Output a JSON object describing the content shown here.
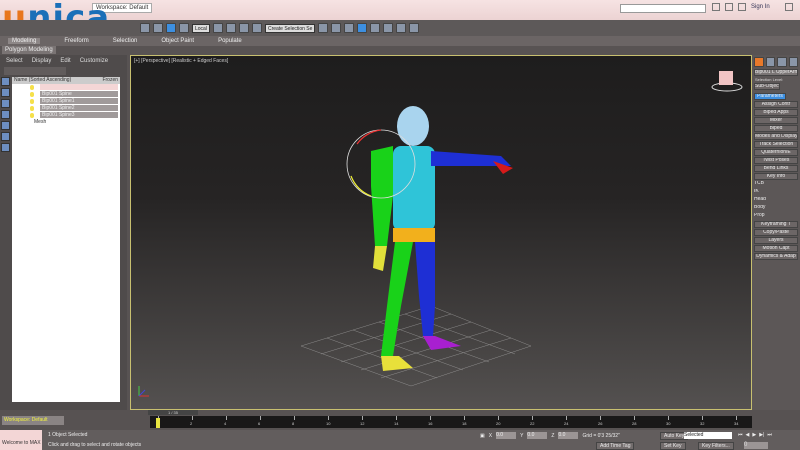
{
  "title": {
    "workspace": "Workspace: Default",
    "sign_in": "Sign In",
    "logo": "unica"
  },
  "toolbar": {
    "coord": "Local",
    "named_selection": "Create Selection Se"
  },
  "ribbon": {
    "tabs": [
      "Modeling",
      "Freeform",
      "Selection",
      "Object Paint",
      "Populate"
    ],
    "sub": "Polygon Modeling"
  },
  "explorer": {
    "menu": [
      "Select",
      "Display",
      "Edit",
      "Customize"
    ],
    "col_name": "Name (Sorted Ascending)",
    "col_frozen": "Frozen",
    "items": [
      "",
      "Bip001 Spine",
      "Bip001 Spine1",
      "Bip001 Spine2",
      "Bip001 Spine3",
      "Mesh"
    ]
  },
  "viewport": {
    "label": "[+] [Perspective] [Realistic + Edged Faces]"
  },
  "command_panel": {
    "object": "Bip001 L UpperArm",
    "selection_level": "Selection Level:",
    "sub_object": "Sub-Object",
    "parameters": "Parameters",
    "rollouts": [
      "Assign Contr",
      "Biped Apps",
      "Mixer",
      "Biped",
      "Modes and Display",
      "Track Selection",
      "Quaternion/E",
      "Twist Poses",
      "Bend Links",
      "Key Info",
      "TCB",
      "IK",
      "Head",
      "Body",
      "Prop",
      "Keyframing T",
      "Copy/Paste",
      "Layers",
      "Motion Capt",
      "Dynamics & Adap"
    ]
  },
  "timeline": {
    "workspace": "Workspace: Default",
    "frame": "1 / 35",
    "ticks": [
      "0",
      "2",
      "4",
      "6",
      "8",
      "10",
      "12",
      "14",
      "16",
      "18",
      "20",
      "22",
      "24",
      "26",
      "28",
      "30",
      "32",
      "34"
    ]
  },
  "status": {
    "welcome": "Welcome to MAX",
    "selected": "1 Object Selected",
    "prompt": "Click and drag to select and rotate objects",
    "x": "0.0",
    "y": "0.0",
    "z": "0.0",
    "grid": "Grid = 0'3 25/32\"",
    "add_time_tag": "Add Time Tag",
    "auto_key": "Auto Key",
    "set_key": "Set Key",
    "selected_dropdown": "Selected",
    "key_filters": "Key Filters...",
    "frame_field": "0"
  }
}
